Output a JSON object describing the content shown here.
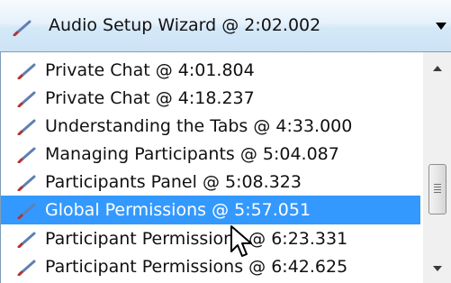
{
  "combo": {
    "selected_label": "Audio Setup Wizard @ 2:02.002",
    "icon": "pencil-icon",
    "dropdown_icon": "chevron-down-icon"
  },
  "list": {
    "items": [
      {
        "label": "Private Chat @ 4:01.804",
        "selected": false
      },
      {
        "label": "Private Chat @ 4:18.237",
        "selected": false
      },
      {
        "label": "Understanding the Tabs @ 4:33.000",
        "selected": false
      },
      {
        "label": "Managing Participants @ 5:04.087",
        "selected": false
      },
      {
        "label": "Participants Panel @ 5:08.323",
        "selected": false
      },
      {
        "label": "Global Permissions @ 5:57.051",
        "selected": true
      },
      {
        "label": "Participant Permissions @ 6:23.331",
        "selected": false
      },
      {
        "label": "Participant Permissions @ 6:42.625",
        "selected": false
      }
    ],
    "item_icon": "pencil-icon"
  },
  "scrollbar": {
    "up_icon": "scroll-up-arrow-icon",
    "down_icon": "scroll-down-arrow-icon",
    "position_fraction": 0.43
  },
  "colors": {
    "selection": "#3399ff",
    "pencil_body": "#5f7fb3",
    "pencil_tip": "#b8342e"
  }
}
